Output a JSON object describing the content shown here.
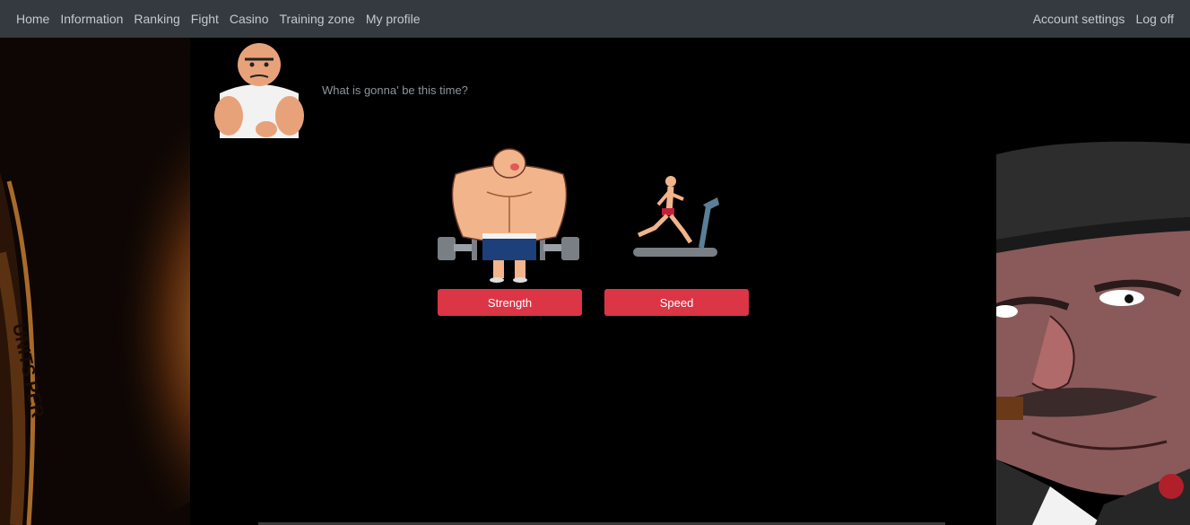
{
  "navbar": {
    "left_links": [
      "Home",
      "Information",
      "Ranking",
      "Fight",
      "Casino",
      "Training zone",
      "My profile"
    ],
    "right_links": [
      "Account settings",
      "Log off"
    ]
  },
  "main": {
    "prompt": "What is gonna' be this time?",
    "options": [
      {
        "label": "Strength",
        "icon": "bodybuilder-dumbbells-icon"
      },
      {
        "label": "Speed",
        "icon": "treadmill-runner-icon"
      }
    ],
    "button_color": "#dc3545"
  },
  "side_images": {
    "left": "coin-closeup-image",
    "right": "mobster-cigar-image"
  }
}
